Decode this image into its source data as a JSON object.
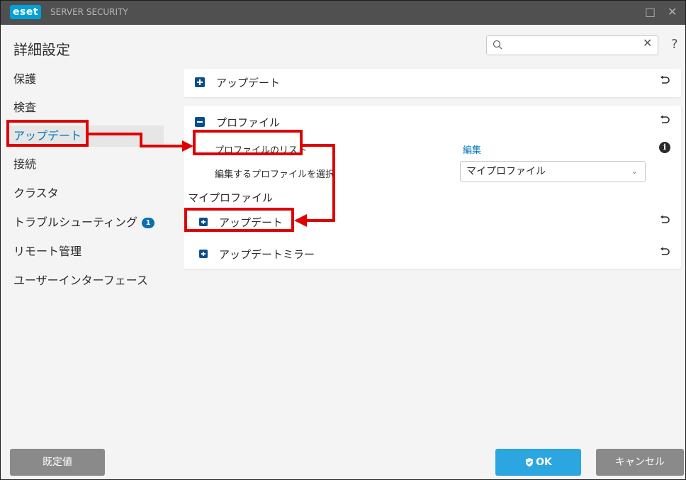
{
  "titlebar": {
    "logo": "eset",
    "product": "SERVER SECURITY",
    "maximize": "□",
    "close": "✕"
  },
  "header": {
    "title": "詳細設定",
    "search_placeholder": "",
    "clear": "✕",
    "help": "?"
  },
  "sidebar": {
    "items": [
      {
        "label": "保護"
      },
      {
        "label": "検査"
      },
      {
        "label": "アップデート"
      },
      {
        "label": "接続"
      },
      {
        "label": "クラスタ"
      },
      {
        "label": "トラブルシューティング",
        "badge": "1"
      },
      {
        "label": "リモート管理"
      },
      {
        "label": "ユーザーインターフェース"
      }
    ]
  },
  "main": {
    "update_section": {
      "label": "アップデート"
    },
    "profiles_section": {
      "label": "プロファイル",
      "profile_list_label": "プロファイルのリスト",
      "edit_link": "編集",
      "select_label": "編集するプロファイルを選択",
      "select_value": "マイプロファイル",
      "profile_title": "マイプロファイル",
      "sub_update": "アップデート",
      "sub_mirror": "アップデートミラー"
    }
  },
  "footer": {
    "default_label": "既定値",
    "ok_label": "OK",
    "cancel_label": "キャンセル"
  },
  "colors": {
    "accent": "#0079b8",
    "highlight": "#e00000",
    "ok": "#2ba6e0",
    "titlebar": "#505050"
  }
}
